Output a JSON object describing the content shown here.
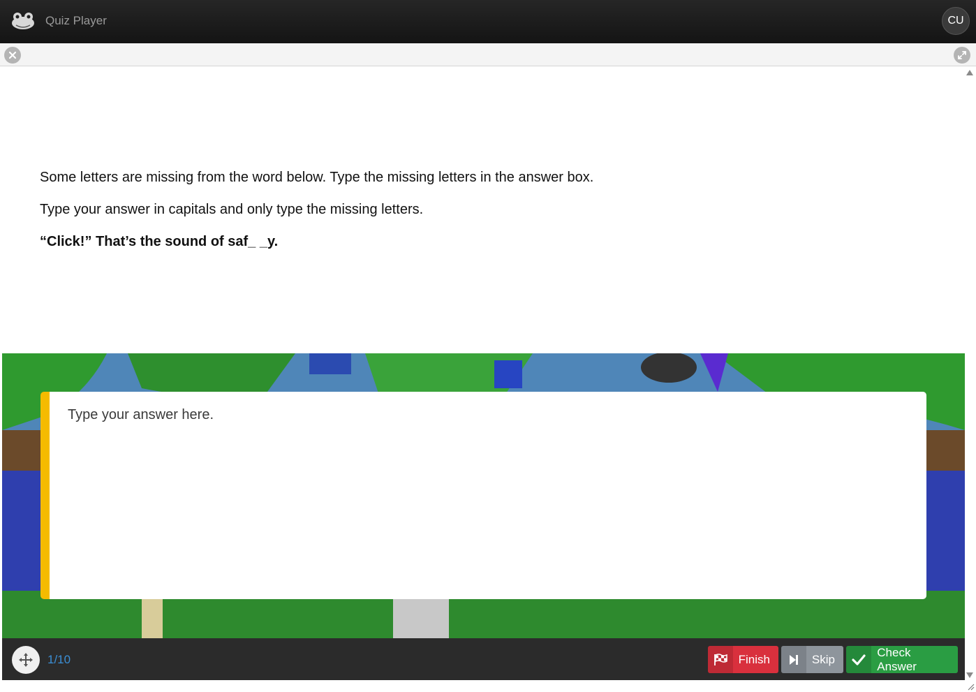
{
  "header": {
    "app_title": "Quiz Player",
    "user_initials": "CU",
    "logo_icon": "frog-icon"
  },
  "toolbar": {
    "close_icon": "close-icon",
    "expand_icon": "expand-icon"
  },
  "question": {
    "instruction_1": "Some letters are missing from the word below. Type the missing letters in the answer box.",
    "instruction_2": "Type your answer in capitals and only type the missing letters.",
    "prompt": "“Click!” That’s the sound of saf_ _y."
  },
  "answer": {
    "placeholder": "Type your answer here.",
    "value": "",
    "accent_color": "#f5bb00"
  },
  "footer": {
    "progress": "1/10",
    "finish_label": "Finish",
    "skip_label": "Skip",
    "check_label": "Check Answer",
    "colors": {
      "finish": "#d9303d",
      "skip": "#8e959c",
      "check": "#2a9d43",
      "progress": "#3b8fd6"
    }
  }
}
